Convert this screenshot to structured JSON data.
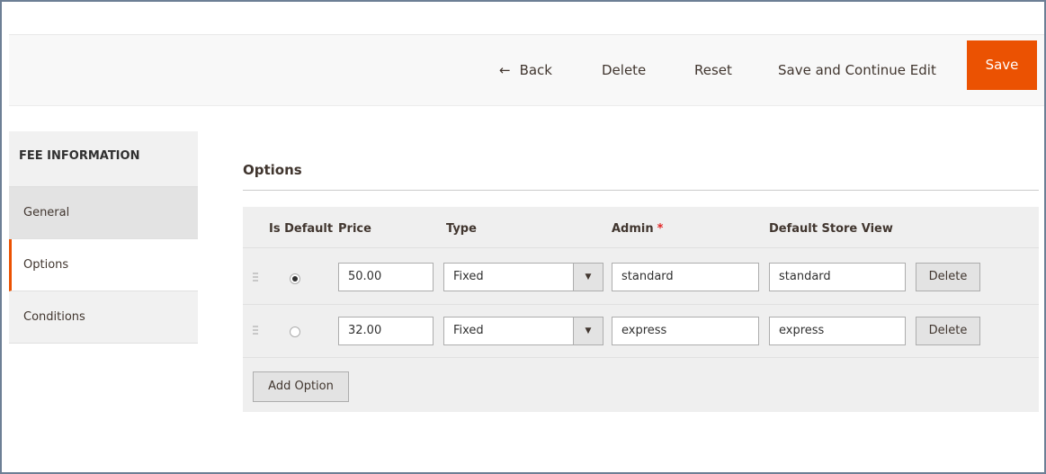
{
  "header": {
    "back_label": "Back",
    "delete_label": "Delete",
    "reset_label": "Reset",
    "save_continue_label": "Save and Continue Edit",
    "save_label": "Save"
  },
  "sidebar": {
    "title": "FEE INFORMATION",
    "items": [
      {
        "label": "General"
      },
      {
        "label": "Options",
        "active": true
      },
      {
        "label": "Conditions"
      }
    ]
  },
  "options": {
    "title": "Options",
    "columns": {
      "is_default": "Is Default",
      "price": "Price",
      "type": "Type",
      "admin": "Admin",
      "admin_required": "*",
      "store_view": "Default Store View"
    },
    "rows": [
      {
        "is_default": true,
        "price": "50.00",
        "type": "Fixed",
        "admin": "standard",
        "store_view": "standard",
        "delete_label": "Delete"
      },
      {
        "is_default": false,
        "price": "32.00",
        "type": "Fixed",
        "admin": "express",
        "store_view": "express",
        "delete_label": "Delete"
      }
    ],
    "add_option_label": "Add Option"
  },
  "colors": {
    "accent": "#eb5202",
    "required": "#e22626",
    "frame": "#6d7f95"
  }
}
